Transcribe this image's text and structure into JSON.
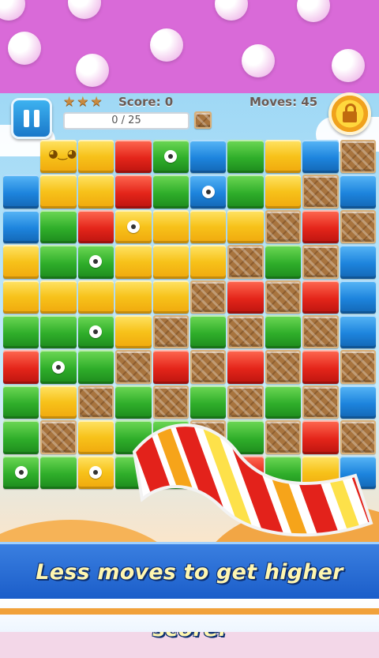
{
  "hud": {
    "score_label": "Score: 0",
    "moves_label": "Moves: 45",
    "stars_earned": 0,
    "stars_total": 3,
    "goal_progress_text": "0 / 25",
    "goal_progress_value": 0,
    "goal_progress_total": 25,
    "goal_icon": "chocolate-block-icon",
    "pause_icon": "pause-icon",
    "booster_icon": "padlock-icon"
  },
  "banner": {
    "text": "Less moves to get higher score."
  },
  "board": {
    "cols": 10,
    "rows": 10,
    "legend": {
      "Y": "yellow-block",
      "G": "green-block",
      "R": "red-block",
      "B": "blue-block",
      "C": "chocolate-block",
      ".": "empty"
    },
    "grid": [
      [
        ".",
        "Y",
        "Y",
        "R",
        "G",
        "B",
        "G",
        "Y",
        "B",
        "C"
      ],
      [
        "B",
        "Y",
        "Y",
        "R",
        "G",
        "B",
        "G",
        "Y",
        "C",
        "B"
      ],
      [
        "B",
        "G",
        "R",
        "Y",
        "Y",
        "Y",
        "Y",
        "C",
        "R",
        "C"
      ],
      [
        "Y",
        "G",
        "G",
        "Y",
        "Y",
        "Y",
        "C",
        "G",
        "C",
        "B"
      ],
      [
        "Y",
        "Y",
        "Y",
        "Y",
        "Y",
        "C",
        "R",
        "C",
        "R",
        "B"
      ],
      [
        "G",
        "G",
        "G",
        "Y",
        "C",
        "G",
        "C",
        "G",
        "C",
        "B"
      ],
      [
        "R",
        "G",
        "G",
        "C",
        "R",
        "C",
        "R",
        "C",
        "R",
        "C"
      ],
      [
        "G",
        "Y",
        "C",
        "G",
        "C",
        "G",
        "C",
        "G",
        "C",
        "B"
      ],
      [
        "G",
        "C",
        "Y",
        "G",
        "G",
        "C",
        "G",
        "C",
        "R",
        "C"
      ],
      [
        "G",
        "G",
        "Y",
        "G",
        "G",
        "G",
        "R",
        "G",
        "Y",
        "B"
      ]
    ],
    "eyes": [
      [
        0,
        4
      ],
      [
        1,
        5
      ],
      [
        2,
        3
      ],
      [
        3,
        2
      ],
      [
        5,
        2
      ],
      [
        6,
        1
      ],
      [
        9,
        0
      ],
      [
        9,
        2
      ]
    ],
    "face_block": [
      0,
      1
    ]
  },
  "colors": {
    "yellow": "#f7c21a",
    "green": "#2fae2a",
    "red": "#e4251a",
    "blue": "#1d84dd",
    "chocolate": "#a8743e",
    "banner": "#1a5cc8",
    "banner_text": "#fff6b0",
    "top_band": "#d96ad8"
  }
}
